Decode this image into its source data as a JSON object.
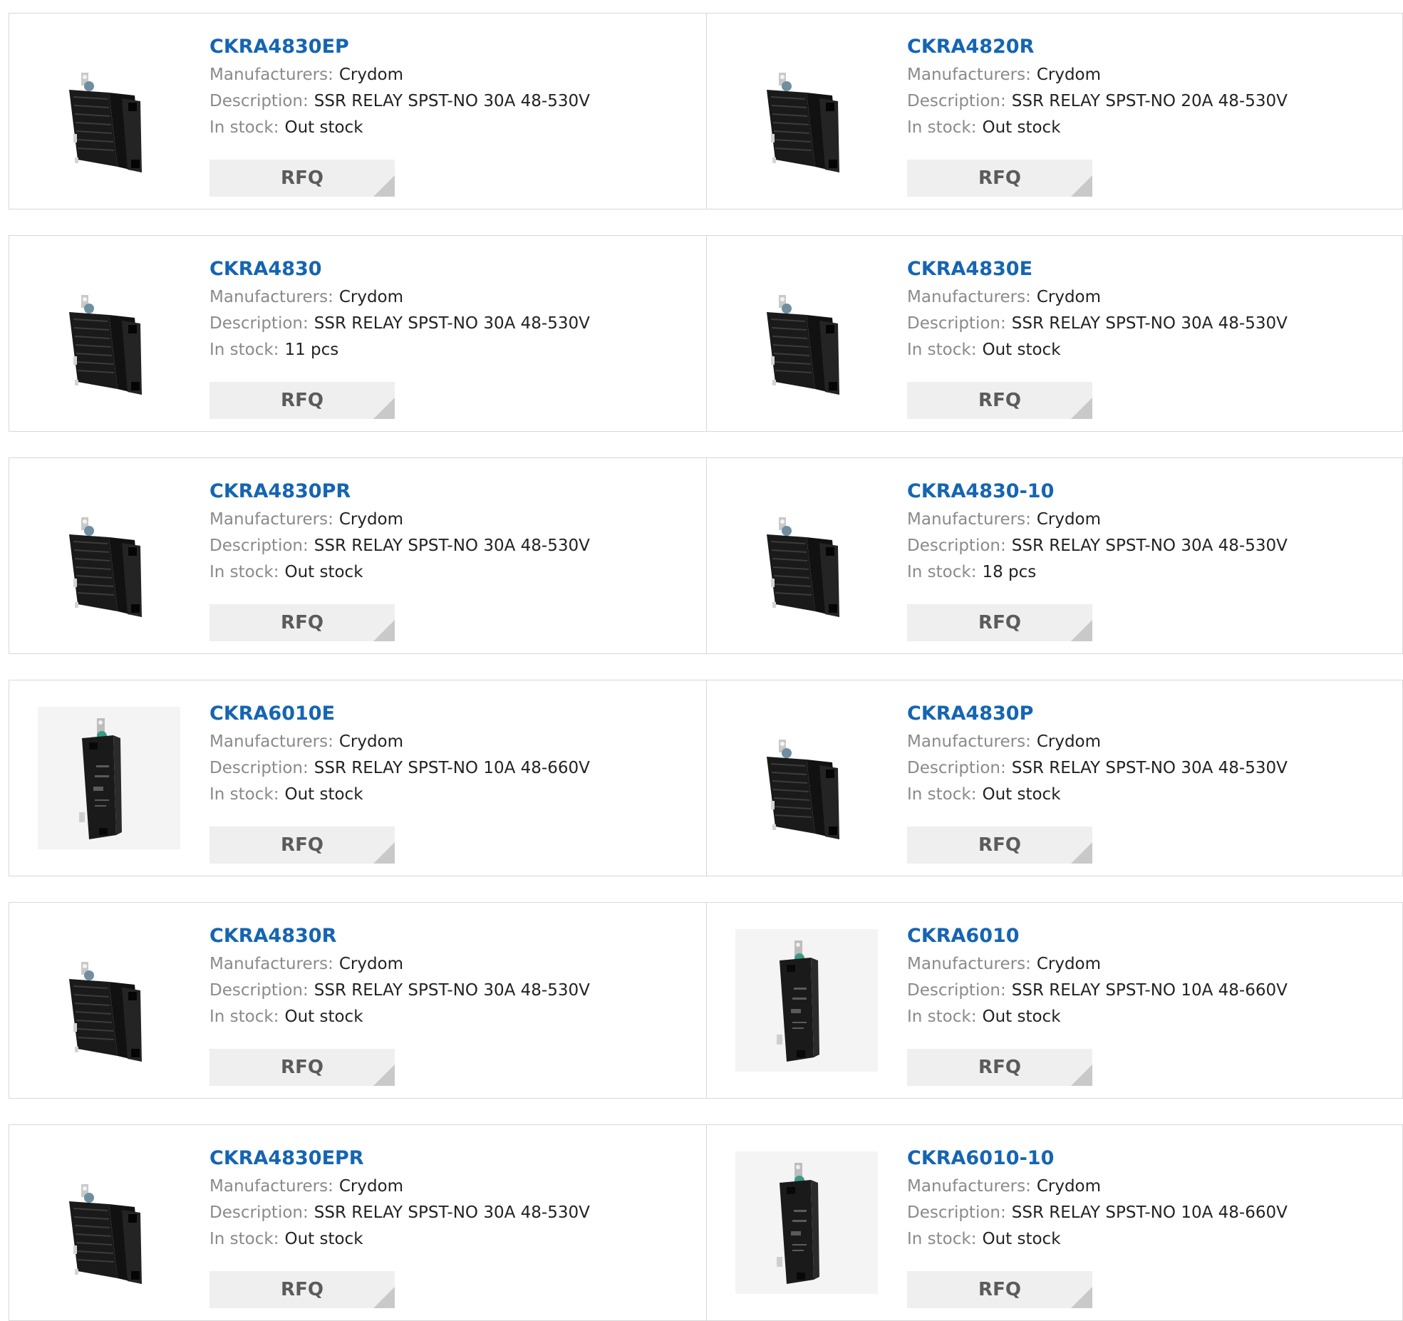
{
  "labels": {
    "manufacturers": "Manufacturers:",
    "description": "Description:",
    "stock": "In stock:",
    "rfq": "RFQ"
  },
  "products": [
    {
      "name": "CKRA4830EP",
      "manufacturer": "Crydom",
      "description": "SSR RELAY SPST-NO 30A 48-530V",
      "stock": "Out stock",
      "image": "heatsink-relay"
    },
    {
      "name": "CKRA4820R",
      "manufacturer": "Crydom",
      "description": "SSR RELAY SPST-NO 20A 48-530V",
      "stock": "Out stock",
      "image": "heatsink-relay"
    },
    {
      "name": "CKRA4830",
      "manufacturer": "Crydom",
      "description": "SSR RELAY SPST-NO 30A 48-530V",
      "stock": "11 pcs",
      "image": "heatsink-relay"
    },
    {
      "name": "CKRA4830E",
      "manufacturer": "Crydom",
      "description": "SSR RELAY SPST-NO 30A 48-530V",
      "stock": "Out stock",
      "image": "heatsink-relay"
    },
    {
      "name": "CKRA4830PR",
      "manufacturer": "Crydom",
      "description": "SSR RELAY SPST-NO 30A 48-530V",
      "stock": "Out stock",
      "image": "heatsink-relay"
    },
    {
      "name": "CKRA4830-10",
      "manufacturer": "Crydom",
      "description": "SSR RELAY SPST-NO 30A 48-530V",
      "stock": "18 pcs",
      "image": "heatsink-relay"
    },
    {
      "name": "CKRA6010E",
      "manufacturer": "Crydom",
      "description": "SSR RELAY SPST-NO 10A 48-660V",
      "stock": "Out stock",
      "image": "slim-relay"
    },
    {
      "name": "CKRA4830P",
      "manufacturer": "Crydom",
      "description": "SSR RELAY SPST-NO 30A 48-530V",
      "stock": "Out stock",
      "image": "heatsink-relay"
    },
    {
      "name": "CKRA4830R",
      "manufacturer": "Crydom",
      "description": "SSR RELAY SPST-NO 30A 48-530V",
      "stock": "Out stock",
      "image": "heatsink-relay"
    },
    {
      "name": "CKRA6010",
      "manufacturer": "Crydom",
      "description": "SSR RELAY SPST-NO 10A 48-660V",
      "stock": "Out stock",
      "image": "slim-relay"
    },
    {
      "name": "CKRA4830EPR",
      "manufacturer": "Crydom",
      "description": "SSR RELAY SPST-NO 30A 48-530V",
      "stock": "Out stock",
      "image": "heatsink-relay"
    },
    {
      "name": "CKRA6010-10",
      "manufacturer": "Crydom",
      "description": "SSR RELAY SPST-NO 10A 48-660V",
      "stock": "Out stock",
      "image": "slim-relay"
    }
  ]
}
